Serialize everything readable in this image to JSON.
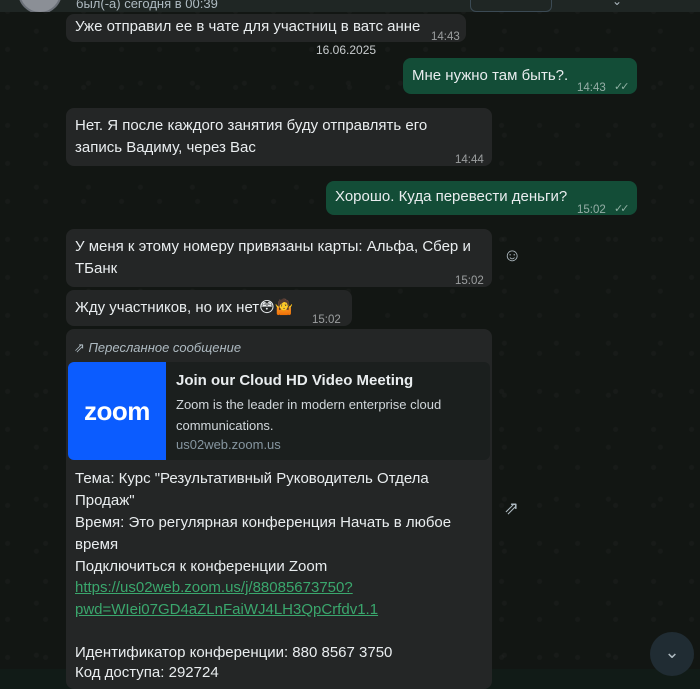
{
  "header": {
    "status": "был(-а) сегодня в 00:39"
  },
  "messages": [
    {
      "id": "m0",
      "text": "Уже отправил ее в чате для участниц в ватс анне",
      "time": "14:43"
    },
    {
      "id": "date",
      "text": "16.06.2025"
    },
    {
      "id": "m1",
      "text": "Мне нужно там быть?.",
      "time": "14:43"
    },
    {
      "id": "m2",
      "line1": "Нет. Я после каждого занятия буду отправлять его",
      "line2": "запись Вадиму, через Вас",
      "time": "14:44"
    },
    {
      "id": "m3",
      "text": "Хорошо. Куда перевести деньги?",
      "time": "15:02"
    },
    {
      "id": "m4",
      "line1": "У меня к этому номеру привязаны карты: Альфа, Сбер и",
      "line2": "ТБанк",
      "time": "15:02"
    },
    {
      "id": "m5",
      "text": "Жду участников, но их нет😳🤷",
      "time": "15:02"
    }
  ],
  "forwarded": {
    "label": "Пересланное сообщение",
    "preview": {
      "logo_text": "zoom",
      "title": "Join our Cloud HD Video Meeting",
      "description": "Zoom is the leader in modern enterprise cloud communications.",
      "host": "us02web.zoom.us"
    },
    "lines": [
      "Тема: Курс \"Результативный Руководитель Отдела",
      "Продаж\"",
      "Время: Это регулярная конференция Начать в любое",
      "время",
      "Подключиться к конференции Zoom"
    ],
    "link_line1": "https://us02web.zoom.us/j/88085673750?",
    "link_line2": "pwd=WIei07GD4aZLnFaiWJ4LH3QpCrfdv1.1",
    "meeting_id": "Идентификатор конференции: 880 8567 3750",
    "cutoff": "Код доступа: 292724"
  },
  "icons": {
    "emoji_react": "smile-icon",
    "forward": "forward-icon",
    "scroll_down": "chevron-down-icon",
    "read_receipt": "double-check-icon"
  }
}
